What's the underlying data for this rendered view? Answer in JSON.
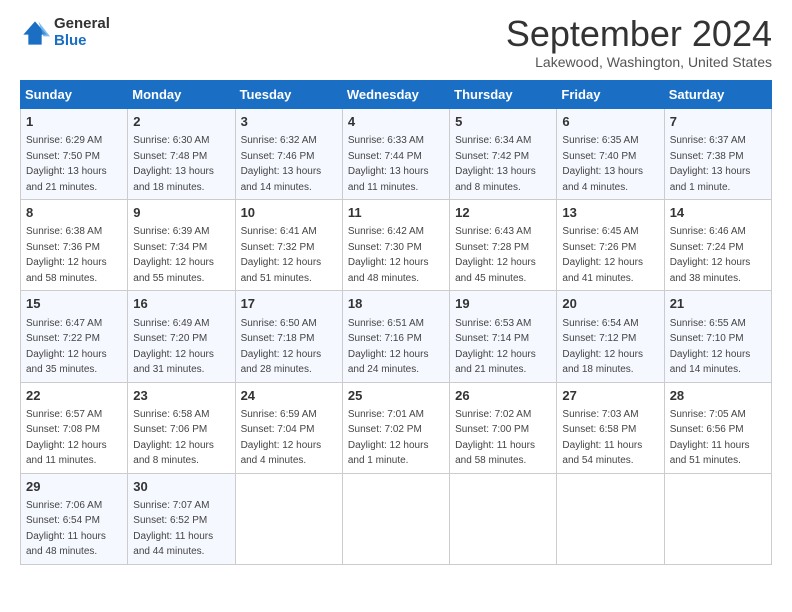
{
  "header": {
    "logo_general": "General",
    "logo_blue": "Blue",
    "month_title": "September 2024",
    "location": "Lakewood, Washington, United States"
  },
  "days_of_week": [
    "Sunday",
    "Monday",
    "Tuesday",
    "Wednesday",
    "Thursday",
    "Friday",
    "Saturday"
  ],
  "weeks": [
    [
      {
        "day": "1",
        "sunrise": "Sunrise: 6:29 AM",
        "sunset": "Sunset: 7:50 PM",
        "daylight": "Daylight: 13 hours and 21 minutes."
      },
      {
        "day": "2",
        "sunrise": "Sunrise: 6:30 AM",
        "sunset": "Sunset: 7:48 PM",
        "daylight": "Daylight: 13 hours and 18 minutes."
      },
      {
        "day": "3",
        "sunrise": "Sunrise: 6:32 AM",
        "sunset": "Sunset: 7:46 PM",
        "daylight": "Daylight: 13 hours and 14 minutes."
      },
      {
        "day": "4",
        "sunrise": "Sunrise: 6:33 AM",
        "sunset": "Sunset: 7:44 PM",
        "daylight": "Daylight: 13 hours and 11 minutes."
      },
      {
        "day": "5",
        "sunrise": "Sunrise: 6:34 AM",
        "sunset": "Sunset: 7:42 PM",
        "daylight": "Daylight: 13 hours and 8 minutes."
      },
      {
        "day": "6",
        "sunrise": "Sunrise: 6:35 AM",
        "sunset": "Sunset: 7:40 PM",
        "daylight": "Daylight: 13 hours and 4 minutes."
      },
      {
        "day": "7",
        "sunrise": "Sunrise: 6:37 AM",
        "sunset": "Sunset: 7:38 PM",
        "daylight": "Daylight: 13 hours and 1 minute."
      }
    ],
    [
      {
        "day": "8",
        "sunrise": "Sunrise: 6:38 AM",
        "sunset": "Sunset: 7:36 PM",
        "daylight": "Daylight: 12 hours and 58 minutes."
      },
      {
        "day": "9",
        "sunrise": "Sunrise: 6:39 AM",
        "sunset": "Sunset: 7:34 PM",
        "daylight": "Daylight: 12 hours and 55 minutes."
      },
      {
        "day": "10",
        "sunrise": "Sunrise: 6:41 AM",
        "sunset": "Sunset: 7:32 PM",
        "daylight": "Daylight: 12 hours and 51 minutes."
      },
      {
        "day": "11",
        "sunrise": "Sunrise: 6:42 AM",
        "sunset": "Sunset: 7:30 PM",
        "daylight": "Daylight: 12 hours and 48 minutes."
      },
      {
        "day": "12",
        "sunrise": "Sunrise: 6:43 AM",
        "sunset": "Sunset: 7:28 PM",
        "daylight": "Daylight: 12 hours and 45 minutes."
      },
      {
        "day": "13",
        "sunrise": "Sunrise: 6:45 AM",
        "sunset": "Sunset: 7:26 PM",
        "daylight": "Daylight: 12 hours and 41 minutes."
      },
      {
        "day": "14",
        "sunrise": "Sunrise: 6:46 AM",
        "sunset": "Sunset: 7:24 PM",
        "daylight": "Daylight: 12 hours and 38 minutes."
      }
    ],
    [
      {
        "day": "15",
        "sunrise": "Sunrise: 6:47 AM",
        "sunset": "Sunset: 7:22 PM",
        "daylight": "Daylight: 12 hours and 35 minutes."
      },
      {
        "day": "16",
        "sunrise": "Sunrise: 6:49 AM",
        "sunset": "Sunset: 7:20 PM",
        "daylight": "Daylight: 12 hours and 31 minutes."
      },
      {
        "day": "17",
        "sunrise": "Sunrise: 6:50 AM",
        "sunset": "Sunset: 7:18 PM",
        "daylight": "Daylight: 12 hours and 28 minutes."
      },
      {
        "day": "18",
        "sunrise": "Sunrise: 6:51 AM",
        "sunset": "Sunset: 7:16 PM",
        "daylight": "Daylight: 12 hours and 24 minutes."
      },
      {
        "day": "19",
        "sunrise": "Sunrise: 6:53 AM",
        "sunset": "Sunset: 7:14 PM",
        "daylight": "Daylight: 12 hours and 21 minutes."
      },
      {
        "day": "20",
        "sunrise": "Sunrise: 6:54 AM",
        "sunset": "Sunset: 7:12 PM",
        "daylight": "Daylight: 12 hours and 18 minutes."
      },
      {
        "day": "21",
        "sunrise": "Sunrise: 6:55 AM",
        "sunset": "Sunset: 7:10 PM",
        "daylight": "Daylight: 12 hours and 14 minutes."
      }
    ],
    [
      {
        "day": "22",
        "sunrise": "Sunrise: 6:57 AM",
        "sunset": "Sunset: 7:08 PM",
        "daylight": "Daylight: 12 hours and 11 minutes."
      },
      {
        "day": "23",
        "sunrise": "Sunrise: 6:58 AM",
        "sunset": "Sunset: 7:06 PM",
        "daylight": "Daylight: 12 hours and 8 minutes."
      },
      {
        "day": "24",
        "sunrise": "Sunrise: 6:59 AM",
        "sunset": "Sunset: 7:04 PM",
        "daylight": "Daylight: 12 hours and 4 minutes."
      },
      {
        "day": "25",
        "sunrise": "Sunrise: 7:01 AM",
        "sunset": "Sunset: 7:02 PM",
        "daylight": "Daylight: 12 hours and 1 minute."
      },
      {
        "day": "26",
        "sunrise": "Sunrise: 7:02 AM",
        "sunset": "Sunset: 7:00 PM",
        "daylight": "Daylight: 11 hours and 58 minutes."
      },
      {
        "day": "27",
        "sunrise": "Sunrise: 7:03 AM",
        "sunset": "Sunset: 6:58 PM",
        "daylight": "Daylight: 11 hours and 54 minutes."
      },
      {
        "day": "28",
        "sunrise": "Sunrise: 7:05 AM",
        "sunset": "Sunset: 6:56 PM",
        "daylight": "Daylight: 11 hours and 51 minutes."
      }
    ],
    [
      {
        "day": "29",
        "sunrise": "Sunrise: 7:06 AM",
        "sunset": "Sunset: 6:54 PM",
        "daylight": "Daylight: 11 hours and 48 minutes."
      },
      {
        "day": "30",
        "sunrise": "Sunrise: 7:07 AM",
        "sunset": "Sunset: 6:52 PM",
        "daylight": "Daylight: 11 hours and 44 minutes."
      },
      null,
      null,
      null,
      null,
      null
    ]
  ]
}
